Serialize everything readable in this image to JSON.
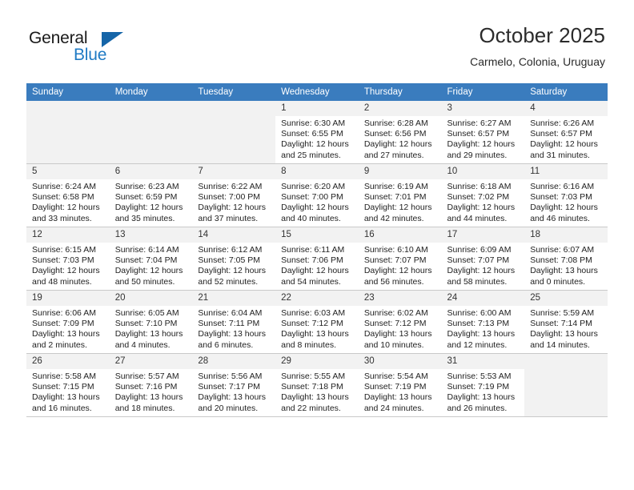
{
  "brand": {
    "name_part1": "General",
    "name_part2": "Blue",
    "logo_icon": "triangle-logo-icon"
  },
  "header": {
    "title": "October 2025",
    "subtitle": "Carmelo, Colonia, Uruguay"
  },
  "calendar": {
    "weekday_headers": [
      "Sunday",
      "Monday",
      "Tuesday",
      "Wednesday",
      "Thursday",
      "Friday",
      "Saturday"
    ],
    "colors": {
      "header_background": "#3a7cbe",
      "header_text": "#ffffff",
      "daynum_background": "#f2f2f2",
      "empty_cell_background": "#f2f2f2",
      "grid_line": "#c9c9c9",
      "brand_blue": "#1f7ac4"
    },
    "weeks": [
      [
        {
          "day": "",
          "sunrise": "",
          "sunset": "",
          "daylight_line1": "",
          "daylight_line2": "",
          "empty": true
        },
        {
          "day": "",
          "sunrise": "",
          "sunset": "",
          "daylight_line1": "",
          "daylight_line2": "",
          "empty": true
        },
        {
          "day": "",
          "sunrise": "",
          "sunset": "",
          "daylight_line1": "",
          "daylight_line2": "",
          "empty": true
        },
        {
          "day": "1",
          "sunrise": "Sunrise: 6:30 AM",
          "sunset": "Sunset: 6:55 PM",
          "daylight_line1": "Daylight: 12 hours",
          "daylight_line2": "and 25 minutes.",
          "empty": false
        },
        {
          "day": "2",
          "sunrise": "Sunrise: 6:28 AM",
          "sunset": "Sunset: 6:56 PM",
          "daylight_line1": "Daylight: 12 hours",
          "daylight_line2": "and 27 minutes.",
          "empty": false
        },
        {
          "day": "3",
          "sunrise": "Sunrise: 6:27 AM",
          "sunset": "Sunset: 6:57 PM",
          "daylight_line1": "Daylight: 12 hours",
          "daylight_line2": "and 29 minutes.",
          "empty": false
        },
        {
          "day": "4",
          "sunrise": "Sunrise: 6:26 AM",
          "sunset": "Sunset: 6:57 PM",
          "daylight_line1": "Daylight: 12 hours",
          "daylight_line2": "and 31 minutes.",
          "empty": false
        }
      ],
      [
        {
          "day": "5",
          "sunrise": "Sunrise: 6:24 AM",
          "sunset": "Sunset: 6:58 PM",
          "daylight_line1": "Daylight: 12 hours",
          "daylight_line2": "and 33 minutes.",
          "empty": false
        },
        {
          "day": "6",
          "sunrise": "Sunrise: 6:23 AM",
          "sunset": "Sunset: 6:59 PM",
          "daylight_line1": "Daylight: 12 hours",
          "daylight_line2": "and 35 minutes.",
          "empty": false
        },
        {
          "day": "7",
          "sunrise": "Sunrise: 6:22 AM",
          "sunset": "Sunset: 7:00 PM",
          "daylight_line1": "Daylight: 12 hours",
          "daylight_line2": "and 37 minutes.",
          "empty": false
        },
        {
          "day": "8",
          "sunrise": "Sunrise: 6:20 AM",
          "sunset": "Sunset: 7:00 PM",
          "daylight_line1": "Daylight: 12 hours",
          "daylight_line2": "and 40 minutes.",
          "empty": false
        },
        {
          "day": "9",
          "sunrise": "Sunrise: 6:19 AM",
          "sunset": "Sunset: 7:01 PM",
          "daylight_line1": "Daylight: 12 hours",
          "daylight_line2": "and 42 minutes.",
          "empty": false
        },
        {
          "day": "10",
          "sunrise": "Sunrise: 6:18 AM",
          "sunset": "Sunset: 7:02 PM",
          "daylight_line1": "Daylight: 12 hours",
          "daylight_line2": "and 44 minutes.",
          "empty": false
        },
        {
          "day": "11",
          "sunrise": "Sunrise: 6:16 AM",
          "sunset": "Sunset: 7:03 PM",
          "daylight_line1": "Daylight: 12 hours",
          "daylight_line2": "and 46 minutes.",
          "empty": false
        }
      ],
      [
        {
          "day": "12",
          "sunrise": "Sunrise: 6:15 AM",
          "sunset": "Sunset: 7:03 PM",
          "daylight_line1": "Daylight: 12 hours",
          "daylight_line2": "and 48 minutes.",
          "empty": false
        },
        {
          "day": "13",
          "sunrise": "Sunrise: 6:14 AM",
          "sunset": "Sunset: 7:04 PM",
          "daylight_line1": "Daylight: 12 hours",
          "daylight_line2": "and 50 minutes.",
          "empty": false
        },
        {
          "day": "14",
          "sunrise": "Sunrise: 6:12 AM",
          "sunset": "Sunset: 7:05 PM",
          "daylight_line1": "Daylight: 12 hours",
          "daylight_line2": "and 52 minutes.",
          "empty": false
        },
        {
          "day": "15",
          "sunrise": "Sunrise: 6:11 AM",
          "sunset": "Sunset: 7:06 PM",
          "daylight_line1": "Daylight: 12 hours",
          "daylight_line2": "and 54 minutes.",
          "empty": false
        },
        {
          "day": "16",
          "sunrise": "Sunrise: 6:10 AM",
          "sunset": "Sunset: 7:07 PM",
          "daylight_line1": "Daylight: 12 hours",
          "daylight_line2": "and 56 minutes.",
          "empty": false
        },
        {
          "day": "17",
          "sunrise": "Sunrise: 6:09 AM",
          "sunset": "Sunset: 7:07 PM",
          "daylight_line1": "Daylight: 12 hours",
          "daylight_line2": "and 58 minutes.",
          "empty": false
        },
        {
          "day": "18",
          "sunrise": "Sunrise: 6:07 AM",
          "sunset": "Sunset: 7:08 PM",
          "daylight_line1": "Daylight: 13 hours",
          "daylight_line2": "and 0 minutes.",
          "empty": false
        }
      ],
      [
        {
          "day": "19",
          "sunrise": "Sunrise: 6:06 AM",
          "sunset": "Sunset: 7:09 PM",
          "daylight_line1": "Daylight: 13 hours",
          "daylight_line2": "and 2 minutes.",
          "empty": false
        },
        {
          "day": "20",
          "sunrise": "Sunrise: 6:05 AM",
          "sunset": "Sunset: 7:10 PM",
          "daylight_line1": "Daylight: 13 hours",
          "daylight_line2": "and 4 minutes.",
          "empty": false
        },
        {
          "day": "21",
          "sunrise": "Sunrise: 6:04 AM",
          "sunset": "Sunset: 7:11 PM",
          "daylight_line1": "Daylight: 13 hours",
          "daylight_line2": "and 6 minutes.",
          "empty": false
        },
        {
          "day": "22",
          "sunrise": "Sunrise: 6:03 AM",
          "sunset": "Sunset: 7:12 PM",
          "daylight_line1": "Daylight: 13 hours",
          "daylight_line2": "and 8 minutes.",
          "empty": false
        },
        {
          "day": "23",
          "sunrise": "Sunrise: 6:02 AM",
          "sunset": "Sunset: 7:12 PM",
          "daylight_line1": "Daylight: 13 hours",
          "daylight_line2": "and 10 minutes.",
          "empty": false
        },
        {
          "day": "24",
          "sunrise": "Sunrise: 6:00 AM",
          "sunset": "Sunset: 7:13 PM",
          "daylight_line1": "Daylight: 13 hours",
          "daylight_line2": "and 12 minutes.",
          "empty": false
        },
        {
          "day": "25",
          "sunrise": "Sunrise: 5:59 AM",
          "sunset": "Sunset: 7:14 PM",
          "daylight_line1": "Daylight: 13 hours",
          "daylight_line2": "and 14 minutes.",
          "empty": false
        }
      ],
      [
        {
          "day": "26",
          "sunrise": "Sunrise: 5:58 AM",
          "sunset": "Sunset: 7:15 PM",
          "daylight_line1": "Daylight: 13 hours",
          "daylight_line2": "and 16 minutes.",
          "empty": false
        },
        {
          "day": "27",
          "sunrise": "Sunrise: 5:57 AM",
          "sunset": "Sunset: 7:16 PM",
          "daylight_line1": "Daylight: 13 hours",
          "daylight_line2": "and 18 minutes.",
          "empty": false
        },
        {
          "day": "28",
          "sunrise": "Sunrise: 5:56 AM",
          "sunset": "Sunset: 7:17 PM",
          "daylight_line1": "Daylight: 13 hours",
          "daylight_line2": "and 20 minutes.",
          "empty": false
        },
        {
          "day": "29",
          "sunrise": "Sunrise: 5:55 AM",
          "sunset": "Sunset: 7:18 PM",
          "daylight_line1": "Daylight: 13 hours",
          "daylight_line2": "and 22 minutes.",
          "empty": false
        },
        {
          "day": "30",
          "sunrise": "Sunrise: 5:54 AM",
          "sunset": "Sunset: 7:19 PM",
          "daylight_line1": "Daylight: 13 hours",
          "daylight_line2": "and 24 minutes.",
          "empty": false
        },
        {
          "day": "31",
          "sunrise": "Sunrise: 5:53 AM",
          "sunset": "Sunset: 7:19 PM",
          "daylight_line1": "Daylight: 13 hours",
          "daylight_line2": "and 26 minutes.",
          "empty": false
        },
        {
          "day": "",
          "sunrise": "",
          "sunset": "",
          "daylight_line1": "",
          "daylight_line2": "",
          "empty": true
        }
      ]
    ]
  }
}
